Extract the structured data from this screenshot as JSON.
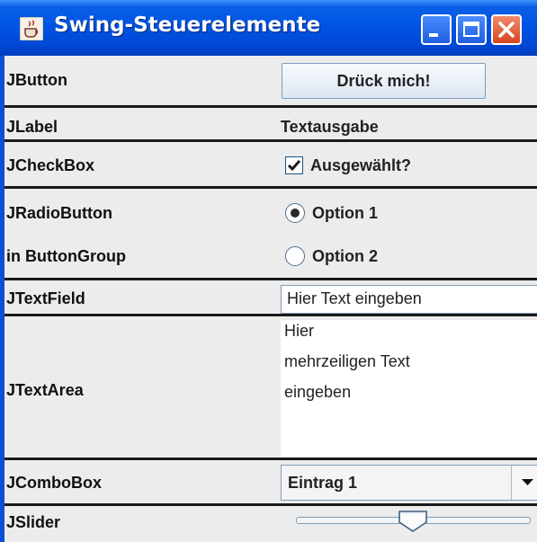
{
  "window": {
    "title": "Swing-Steuerelemente",
    "icons": {
      "app": "java-cup-icon",
      "minimize": "minimize-icon",
      "maximize": "maximize-icon",
      "close": "close-icon"
    },
    "colors": {
      "titlebar": "#0054e3",
      "close": "#d6461f",
      "content_bg": "#ececec"
    }
  },
  "rows": {
    "button": {
      "label": "JButton",
      "text": "Drück mich!"
    },
    "label": {
      "label": "JLabel",
      "text": "Textausgabe"
    },
    "checkbox": {
      "label": "JCheckBox",
      "text": "Ausgewählt?",
      "checked": true
    },
    "radio": {
      "label": "JRadioButton",
      "label2": "in ButtonGroup",
      "options": [
        {
          "text": "Option 1",
          "selected": true
        },
        {
          "text": "Option 2",
          "selected": false
        }
      ]
    },
    "textfield": {
      "label": "JTextField",
      "value": "Hier Text eingeben"
    },
    "textarea": {
      "label": "JTextArea",
      "lines": [
        "Hier",
        "mehrzeiligen Text",
        "eingeben"
      ]
    },
    "combobox": {
      "label": "JComboBox",
      "selected": "Eintrag 1"
    },
    "slider": {
      "label": "JSlider",
      "value_fraction": 0.5
    }
  }
}
